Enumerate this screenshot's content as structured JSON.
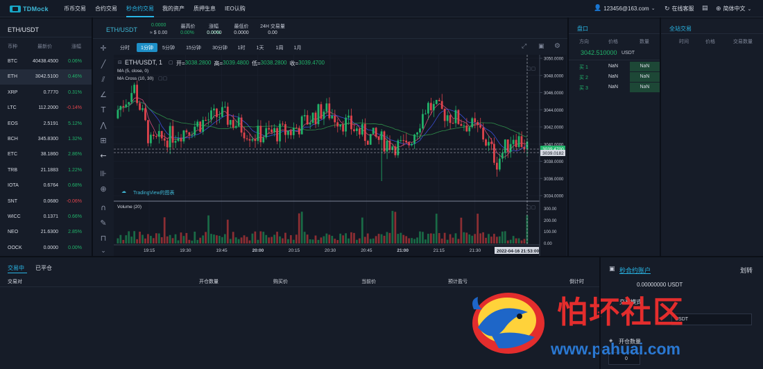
{
  "nav": {
    "logo": "TDMock",
    "items": [
      "币币交易",
      "合约交易",
      "秒合约交易",
      "我的资产",
      "质押生息",
      "IEO认购"
    ],
    "active_index": 2,
    "user": "123456@163.com",
    "support": "在线客服",
    "language": "简体中文"
  },
  "market": {
    "title": "ETH/USDT",
    "headers": [
      "币种",
      "最新价",
      "涨幅"
    ],
    "rows": [
      {
        "symbol": "BTC",
        "price": "40438.4500",
        "change": "0.06%",
        "dir": "up"
      },
      {
        "symbol": "ETH",
        "price": "3042.5100",
        "change": "0.46%",
        "dir": "up"
      },
      {
        "symbol": "XRP",
        "price": "0.7770",
        "change": "0.31%",
        "dir": "up"
      },
      {
        "symbol": "LTC",
        "price": "112.2000",
        "change": "-0.14%",
        "dir": "down"
      },
      {
        "symbol": "EOS",
        "price": "2.5191",
        "change": "5.12%",
        "dir": "up"
      },
      {
        "symbol": "BCH",
        "price": "345.8300",
        "change": "1.32%",
        "dir": "up"
      },
      {
        "symbol": "ETC",
        "price": "38.1860",
        "change": "2.86%",
        "dir": "up"
      },
      {
        "symbol": "TRB",
        "price": "21.1883",
        "change": "1.22%",
        "dir": "up"
      },
      {
        "symbol": "IOTA",
        "price": "0.6764",
        "change": "0.68%",
        "dir": "up"
      },
      {
        "symbol": "SNT",
        "price": "0.0680",
        "change": "-0.06%",
        "dir": "down"
      },
      {
        "symbol": "WICC",
        "price": "0.1371",
        "change": "0.66%",
        "dir": "up"
      },
      {
        "symbol": "NEO",
        "price": "21.6300",
        "change": "2.85%",
        "dir": "up"
      },
      {
        "symbol": "OOCK",
        "price": "0.0000",
        "change": "0.00%",
        "dir": "up"
      }
    ],
    "selected_index": 1
  },
  "ticker": {
    "pair": "ETH/USDT",
    "last": "0.0000",
    "approx": "≈ $ 0.00",
    "stats": [
      {
        "label": "",
        "value": "0.00%"
      },
      {
        "label": "涨幅",
        "value": "0.00%"
      },
      {
        "label": "最高价",
        "value": "0.0000"
      },
      {
        "label": "最低价",
        "value": "0.0000"
      },
      {
        "label": "24H 交易量",
        "value": "0.00"
      }
    ]
  },
  "timeframes": [
    "分时",
    "1分钟",
    "5分钟",
    "15分钟",
    "30分钟",
    "1时",
    "1天",
    "1周",
    "1月"
  ],
  "timeframe_active": 1,
  "chart": {
    "symbol_line": "ETH/USDT, 1",
    "ohlc": {
      "open_label": "开=",
      "open": "3038.2800",
      "high_label": "高=",
      "high": "3039.4800",
      "low_label": "低=",
      "low": "3038.2800",
      "close_label": "收=",
      "close": "3039.4700"
    },
    "ma_label": "MA (5, close, 0)",
    "ma_cross_label": "MA Cross (10, 30)",
    "tradingview_label": "TradingView的图表",
    "volume_label": "Volume (20)",
    "price_ticks": [
      "3050.0000",
      "3048.0000",
      "3046.0000",
      "3044.0000",
      "3042.0000",
      "3040.0000",
      "3038.0000",
      "3036.0000",
      "3034.0000"
    ],
    "last_price_tag": "3039.4700",
    "cross_price_tag": "3039.0182",
    "volume_ticks": [
      "300.00",
      "200.00",
      "100.00",
      "0.00"
    ],
    "time_ticks": [
      "19:15",
      "19:30",
      "19:45",
      "20:00",
      "20:15",
      "20:30",
      "20:45",
      "21:00",
      "21:15",
      "21:30"
    ],
    "time_ticks_bold": [
      "20:00",
      "21:00"
    ],
    "cursor_time": "2022-04-16 21:53:00"
  },
  "orderbook": {
    "title": "盘口",
    "headers": [
      "方向",
      "价格",
      "数量"
    ],
    "mid_price": "3042.510000",
    "mid_unit": "USDT",
    "rows": [
      {
        "side": "买 1",
        "price": "NaN",
        "qty": "NaN"
      },
      {
        "side": "买 2",
        "price": "NaN",
        "qty": "NaN"
      },
      {
        "side": "买 3",
        "price": "NaN",
        "qty": "NaN"
      }
    ]
  },
  "trades": {
    "title": "全站交易",
    "headers": [
      "时间",
      "价格",
      "交易数量"
    ]
  },
  "positions": {
    "tabs": [
      "交易中",
      "已平仓"
    ],
    "active_tab": 0,
    "columns": [
      "交易对",
      "开仓数量",
      "购买价",
      "当前价",
      "预计盈亏",
      "倒计时"
    ]
  },
  "account": {
    "title": "秒合约账户",
    "transfer": "划转",
    "balance": "0.00000000 USDT",
    "trade_type_label": "交易模式",
    "currency_value": "USDT",
    "open_qty_label": "开仓数量",
    "open_qty_value": "0"
  },
  "watermark": {
    "cn": "怕坏社区",
    "url": "www.pahuai.com"
  },
  "colors": {
    "accent": "#29b6e6",
    "up": "#21b36a",
    "down": "#e0444c",
    "bg": "#10151f",
    "panel": "#161c28"
  }
}
